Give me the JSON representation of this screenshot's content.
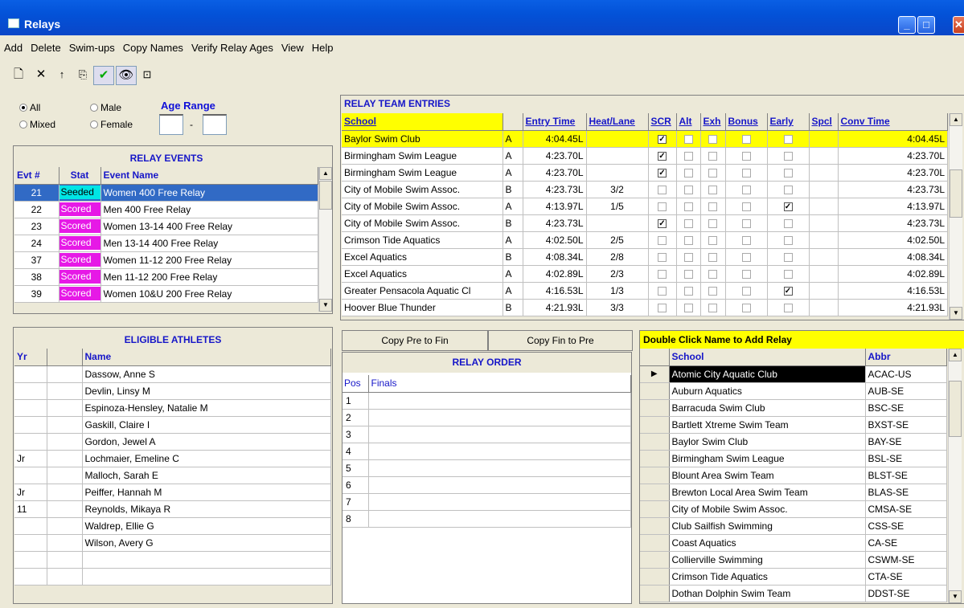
{
  "window": {
    "title": "Relays"
  },
  "menu": [
    "Add",
    "Delete",
    "Swim-ups",
    "Copy Names",
    "Verify Relay Ages",
    "View",
    "Help"
  ],
  "toolbar": {
    "icons": [
      "new-icon",
      "delete-icon",
      "up-arrow-icon",
      "copy-icon",
      "check-icon",
      "eye-icon",
      "folder-up-icon"
    ]
  },
  "filters": {
    "all": "All",
    "male": "Male",
    "mixed": "Mixed",
    "female": "Female",
    "age_range": "Age Range",
    "age_sep": "-",
    "selected": "All"
  },
  "relay_events": {
    "title": "RELAY EVENTS",
    "cols": [
      "Evt #",
      "Stat",
      "Event Name"
    ],
    "rows": [
      {
        "evt": "21",
        "stat": "Seeded",
        "name": "Women 400 Free Relay"
      },
      {
        "evt": "22",
        "stat": "Scored",
        "name": "Men 400 Free Relay"
      },
      {
        "evt": "23",
        "stat": "Scored",
        "name": "Women 13-14 400 Free Relay"
      },
      {
        "evt": "24",
        "stat": "Scored",
        "name": "Men 13-14 400 Free Relay"
      },
      {
        "evt": "37",
        "stat": "Scored",
        "name": "Women 11-12 200 Free Relay"
      },
      {
        "evt": "38",
        "stat": "Scored",
        "name": "Men 11-12 200 Free Relay"
      },
      {
        "evt": "39",
        "stat": "Scored",
        "name": "Women 10&U 200 Free Relay"
      }
    ]
  },
  "athletes": {
    "title": "ELIGIBLE ATHLETES",
    "cols": [
      "Yr",
      "",
      "Name"
    ],
    "rows": [
      {
        "yr": "",
        "name": "Dassow, Anne S"
      },
      {
        "yr": "",
        "name": "Devlin, Linsy M"
      },
      {
        "yr": "",
        "name": "Espinoza-Hensley, Natalie M"
      },
      {
        "yr": "",
        "name": "Gaskill, Claire I"
      },
      {
        "yr": "",
        "name": "Gordon, Jewel A"
      },
      {
        "yr": "Jr",
        "name": "Lochmaier, Emeline C"
      },
      {
        "yr": "",
        "name": "Malloch, Sarah E"
      },
      {
        "yr": "Jr",
        "name": "Peiffer, Hannah M"
      },
      {
        "yr": "11",
        "name": "Reynolds, Mikaya R"
      },
      {
        "yr": "",
        "name": "Waldrep, Ellie G"
      },
      {
        "yr": "",
        "name": "Wilson, Avery G"
      },
      {
        "yr": "",
        "name": ""
      },
      {
        "yr": "",
        "name": ""
      }
    ]
  },
  "entries": {
    "title": "RELAY TEAM ENTRIES",
    "cols": [
      "School",
      "",
      "Entry Time",
      "Heat/Lane",
      "SCR",
      "Alt",
      "Exh",
      "Bonus",
      "Early",
      "Spcl",
      "Conv Time"
    ],
    "rows": [
      {
        "school": "Baylor Swim Club",
        "team": "A",
        "time": "4:04.45L",
        "hl": "",
        "scr": true,
        "early": false,
        "conv": "4:04.45L"
      },
      {
        "school": "Birmingham Swim League",
        "team": "A",
        "time": "4:23.70L",
        "hl": "",
        "scr": true,
        "early": false,
        "conv": "4:23.70L"
      },
      {
        "school": "Birmingham Swim League",
        "team": "A",
        "time": "4:23.70L",
        "hl": "",
        "scr": true,
        "early": false,
        "conv": "4:23.70L"
      },
      {
        "school": "City of Mobile Swim Assoc.",
        "team": "B",
        "time": "4:23.73L",
        "hl": "3/2",
        "scr": false,
        "early": false,
        "conv": "4:23.73L"
      },
      {
        "school": "City of Mobile Swim Assoc.",
        "team": "A",
        "time": "4:13.97L",
        "hl": "1/5",
        "scr": false,
        "early": true,
        "conv": "4:13.97L"
      },
      {
        "school": "City of Mobile Swim Assoc.",
        "team": "B",
        "time": "4:23.73L",
        "hl": "",
        "scr": true,
        "early": false,
        "conv": "4:23.73L"
      },
      {
        "school": "Crimson Tide Aquatics",
        "team": "A",
        "time": "4:02.50L",
        "hl": "2/5",
        "scr": false,
        "early": false,
        "conv": "4:02.50L"
      },
      {
        "school": "Excel Aquatics",
        "team": "B",
        "time": "4:08.34L",
        "hl": "2/8",
        "scr": false,
        "early": false,
        "conv": "4:08.34L"
      },
      {
        "school": "Excel Aquatics",
        "team": "A",
        "time": "4:02.89L",
        "hl": "2/3",
        "scr": false,
        "early": false,
        "conv": "4:02.89L"
      },
      {
        "school": "Greater Pensacola Aquatic Cl",
        "team": "A",
        "time": "4:16.53L",
        "hl": "1/3",
        "scr": false,
        "early": true,
        "conv": "4:16.53L"
      },
      {
        "school": "Hoover Blue Thunder",
        "team": "B",
        "time": "4:21.93L",
        "hl": "3/3",
        "scr": false,
        "early": false,
        "conv": "4:21.93L"
      }
    ]
  },
  "buttons": {
    "copy_pre_fin": "Copy Pre to Fin",
    "copy_fin_pre": "Copy Fin to Pre"
  },
  "relay_order": {
    "title": "RELAY ORDER",
    "cols": [
      "Pos",
      "Finals"
    ],
    "positions": [
      "1",
      "2",
      "3",
      "4",
      "5",
      "6",
      "7",
      "8"
    ]
  },
  "schools": {
    "title": "Double Click Name to Add Relay",
    "cols": [
      "School",
      "Abbr"
    ],
    "rows": [
      {
        "name": "Atomic City Aquatic Club",
        "abbr": "ACAC-US"
      },
      {
        "name": "Auburn Aquatics",
        "abbr": "AUB-SE"
      },
      {
        "name": "Barracuda Swim Club",
        "abbr": "BSC-SE"
      },
      {
        "name": "Bartlett Xtreme Swim Team",
        "abbr": "BXST-SE"
      },
      {
        "name": "Baylor Swim Club",
        "abbr": "BAY-SE"
      },
      {
        "name": "Birmingham Swim League",
        "abbr": "BSL-SE"
      },
      {
        "name": "Blount Area Swim Team",
        "abbr": "BLST-SE"
      },
      {
        "name": "Brewton Local Area Swim Team",
        "abbr": "BLAS-SE"
      },
      {
        "name": "City of Mobile Swim Assoc.",
        "abbr": "CMSA-SE"
      },
      {
        "name": "Club Sailfish Swimming",
        "abbr": "CSS-SE"
      },
      {
        "name": "Coast Aquatics",
        "abbr": "CA-SE"
      },
      {
        "name": "Collierville Swimming",
        "abbr": "CSWM-SE"
      },
      {
        "name": "Crimson Tide Aquatics",
        "abbr": "CTA-SE"
      },
      {
        "name": "Dothan Dolphin Swim Team",
        "abbr": "DDST-SE"
      }
    ]
  }
}
